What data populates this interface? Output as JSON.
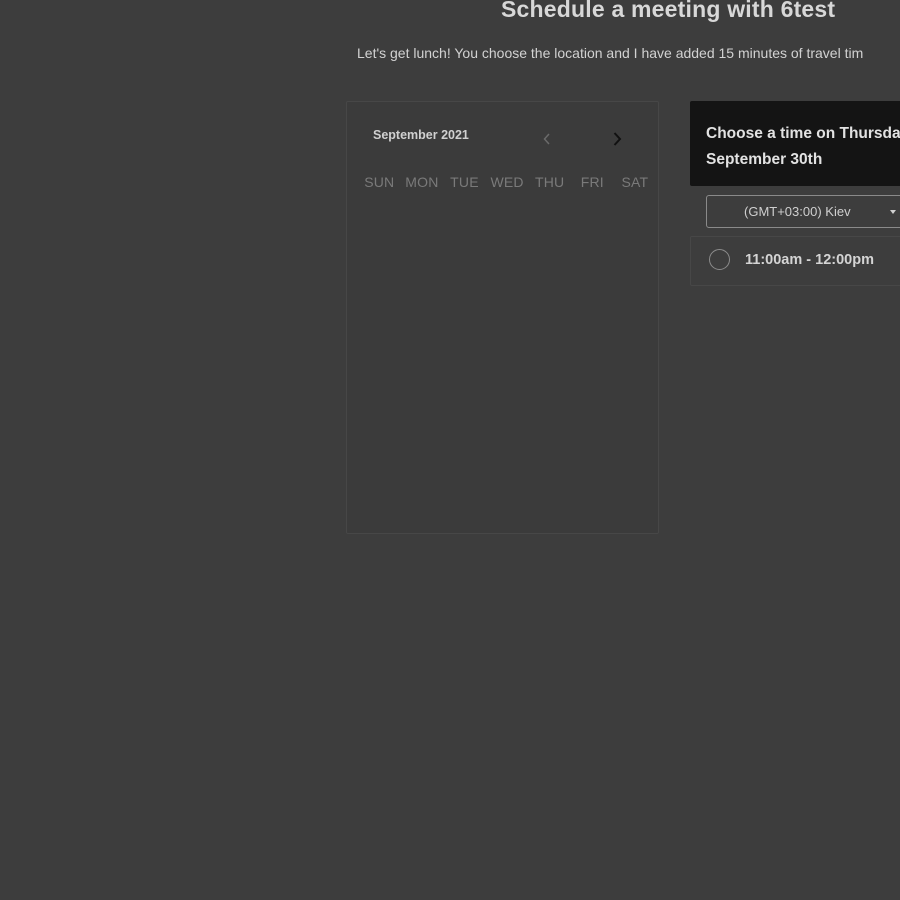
{
  "header": {
    "title": "Schedule a meeting with 6test",
    "subtitle": "Let's get lunch! You choose the location and I have added 15 minutes of travel tim"
  },
  "calendar": {
    "month_label": "September 2021",
    "prev_icon": "chevron-left-icon",
    "next_icon": "chevron-right-icon",
    "weekdays": [
      "SUN",
      "MON",
      "TUE",
      "WED",
      "THU",
      "FRI",
      "SAT"
    ]
  },
  "time_panel": {
    "heading_line1": "Choose a time on Thursda",
    "heading_line2": "September 30th",
    "timezone": "(GMT+03:00) Kiev",
    "slots": [
      {
        "label": "11:00am - 12:00pm"
      }
    ]
  },
  "colors": {
    "background": "#3d3d3d",
    "header_panel": "#141414",
    "weekday_text": "#7a7a7a"
  }
}
